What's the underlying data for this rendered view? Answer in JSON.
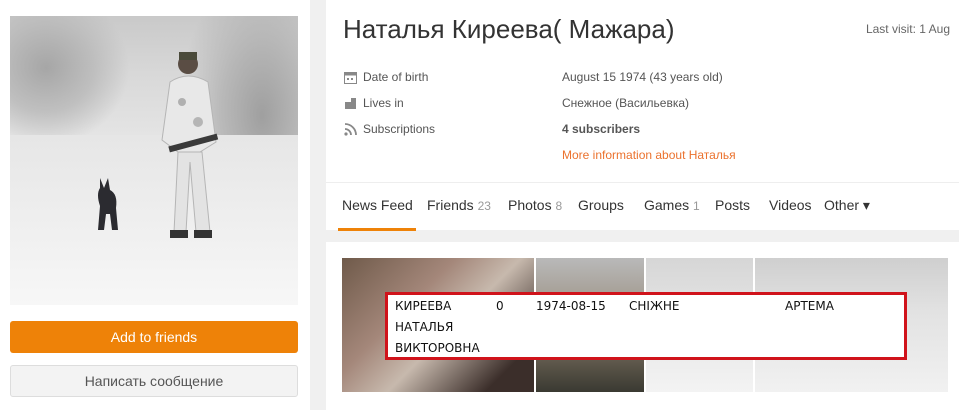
{
  "profile": {
    "name": "Наталья Киреева( Мажара)",
    "last_visit": "Last visit: 1 Aug"
  },
  "info": {
    "rows": [
      {
        "icon": "calendar-icon",
        "label": "Date of birth",
        "value": "August 15 1974 (43 years old)"
      },
      {
        "icon": "home-icon",
        "label": "Lives in",
        "value": "Снежное (Васильевка)"
      },
      {
        "icon": "rss-icon",
        "label": "Subscriptions",
        "value": "4 subscribers"
      }
    ],
    "more_link": "More information about Наталья"
  },
  "buttons": {
    "add_friends": "Add to friends",
    "send_message": "Написать сообщение"
  },
  "tabs": [
    {
      "label": "News Feed",
      "count": ""
    },
    {
      "label": "Friends",
      "count": "23"
    },
    {
      "label": "Photos",
      "count": "8"
    },
    {
      "label": "Groups",
      "count": ""
    },
    {
      "label": "Games",
      "count": "1"
    },
    {
      "label": "Posts",
      "count": ""
    },
    {
      "label": "Videos",
      "count": ""
    },
    {
      "label": "Other ▾",
      "count": ""
    }
  ],
  "overlay": {
    "surname": "КИРЕЕВА",
    "firstname": "НАТАЛЬЯ",
    "patronymic": "ВИКТОРОВНА",
    "zero": "0",
    "date": "1974-08-15",
    "town": "СНІЖНЕ",
    "street": "АРТЕМА"
  },
  "colors": {
    "accent": "#ee8208",
    "link": "#eb722e",
    "highlight_border": "#d0131b"
  }
}
